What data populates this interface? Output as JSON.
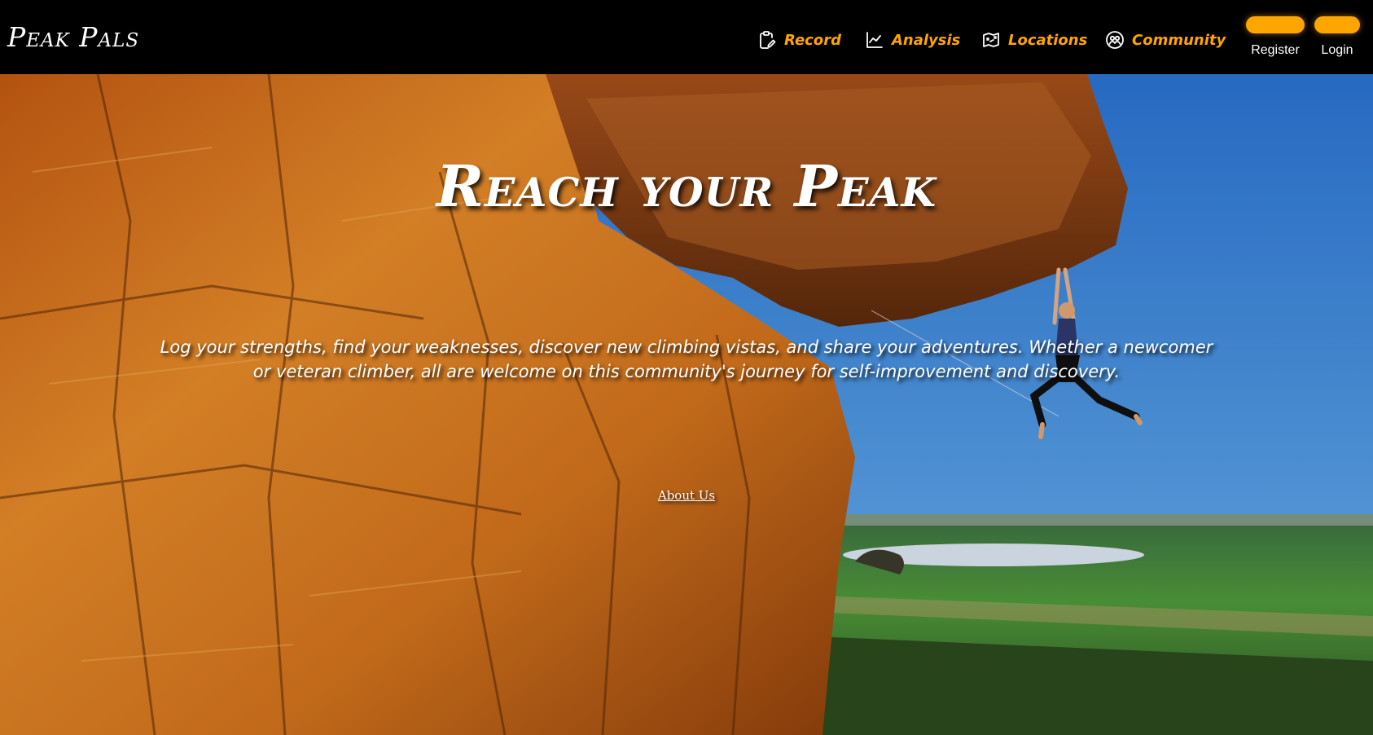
{
  "brand": {
    "logo_text": "Peak Pals"
  },
  "nav": {
    "items": [
      {
        "label": "Record",
        "icon": "clipboard-pencil-icon"
      },
      {
        "label": "Analysis",
        "icon": "line-chart-icon"
      },
      {
        "label": "Locations",
        "icon": "map-icon"
      },
      {
        "label": "Community",
        "icon": "people-circle-icon"
      }
    ]
  },
  "auth": {
    "register_label": "Register",
    "login_label": "Login"
  },
  "hero": {
    "title": "Reach your Peak",
    "tagline": "Log your strengths, find your weaknesses, discover new climbing vistas, and share your adventures. Whether a newcomer or veteran climber, all are welcome on this community's journey for self-improvement and discovery.",
    "about_label": "About Us"
  },
  "colors": {
    "accent": "#ffa500",
    "header_bg": "#000000",
    "text": "#ffffff"
  }
}
